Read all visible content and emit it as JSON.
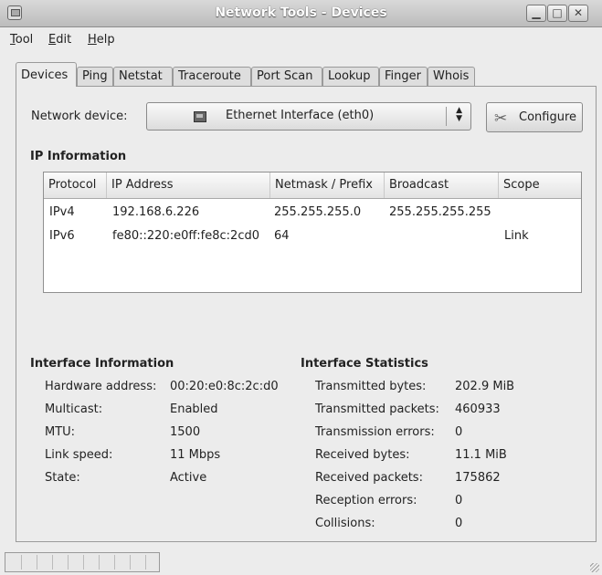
{
  "window": {
    "title": "Network Tools - Devices",
    "buttons": [
      "minimize",
      "maximize",
      "close"
    ]
  },
  "menu": [
    {
      "label": "Tool",
      "mnemonic": "T"
    },
    {
      "label": "Edit",
      "mnemonic": "E"
    },
    {
      "label": "Help",
      "mnemonic": "H"
    }
  ],
  "tabs": [
    "Devices",
    "Ping",
    "Netstat",
    "Traceroute",
    "Port Scan",
    "Lookup",
    "Finger",
    "Whois"
  ],
  "active_tab": "Devices",
  "device": {
    "label": "Network device:",
    "selected": "Ethernet Interface (eth0)",
    "configure_label": "Configure"
  },
  "ip_info": {
    "heading": "IP Information",
    "columns": [
      "Protocol",
      "IP Address",
      "Netmask / Prefix",
      "Broadcast",
      "Scope"
    ],
    "rows": [
      [
        "IPv4",
        "192.168.6.226",
        "255.255.255.0",
        "255.255.255.255",
        ""
      ],
      [
        "IPv6",
        "fe80::220:e0ff:fe8c:2cd0",
        "64",
        "",
        "Link"
      ]
    ]
  },
  "interface_info": {
    "heading": "Interface Information",
    "items": [
      {
        "label": "Hardware address:",
        "value": "00:20:e0:8c:2c:d0"
      },
      {
        "label": "Multicast:",
        "value": "Enabled"
      },
      {
        "label": "MTU:",
        "value": "1500"
      },
      {
        "label": "Link speed:",
        "value": "11 Mbps"
      },
      {
        "label": "State:",
        "value": "Active"
      }
    ]
  },
  "interface_stats": {
    "heading": "Interface Statistics",
    "items": [
      {
        "label": "Transmitted bytes:",
        "value": "202.9 MiB"
      },
      {
        "label": "Transmitted packets:",
        "value": "460933"
      },
      {
        "label": "Transmission errors:",
        "value": "0"
      },
      {
        "label": "Received bytes:",
        "value": "11.1 MiB"
      },
      {
        "label": "Received packets:",
        "value": "175862"
      },
      {
        "label": "Reception errors:",
        "value": "0"
      },
      {
        "label": "Collisions:",
        "value": "0"
      }
    ]
  }
}
